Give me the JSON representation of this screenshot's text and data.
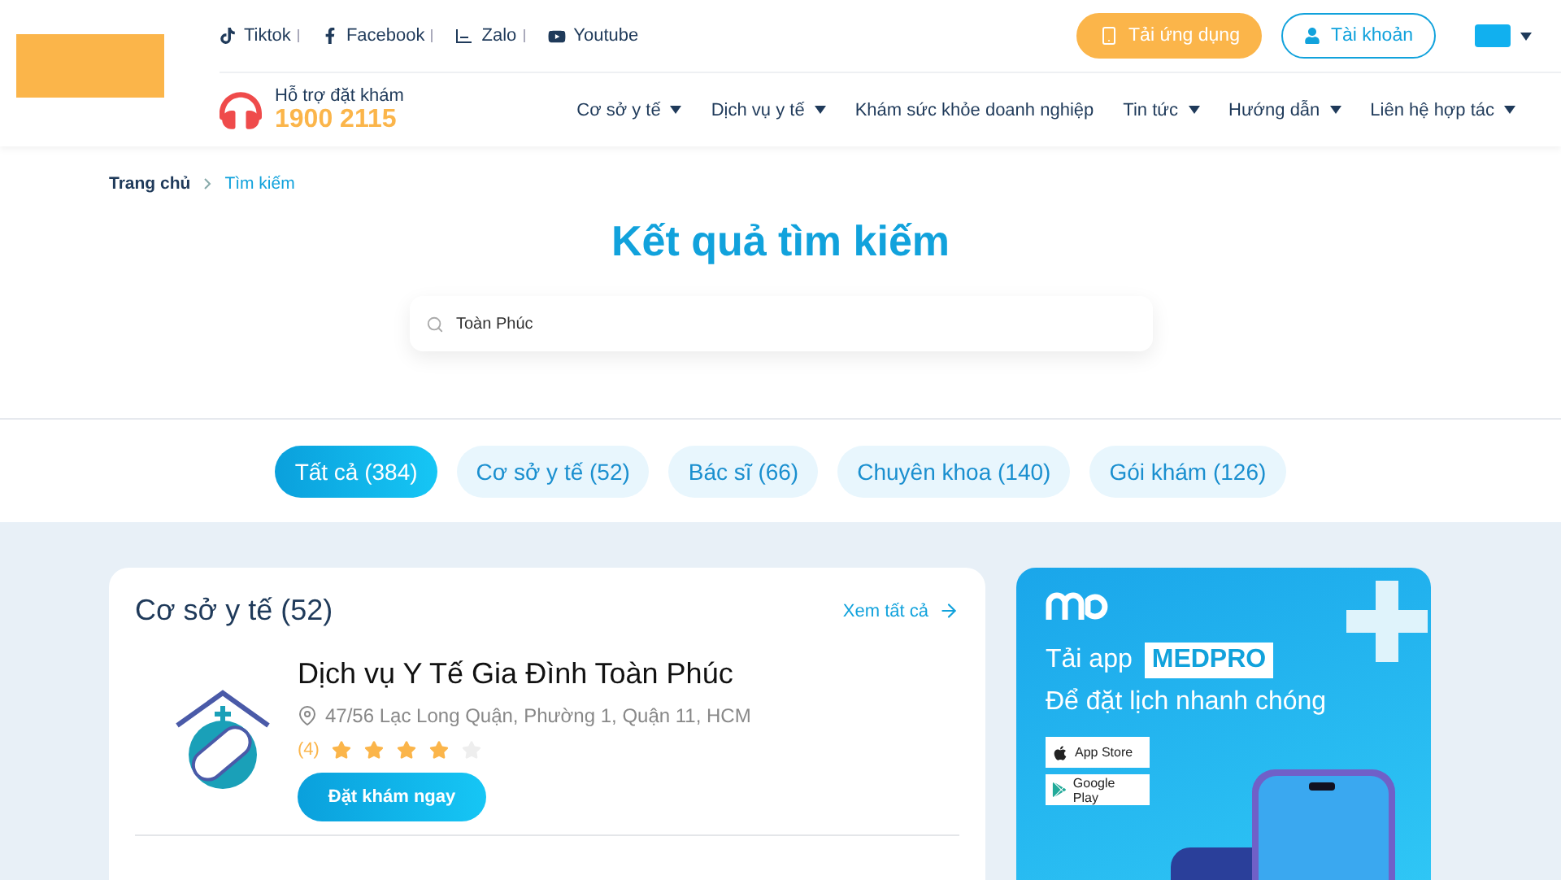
{
  "social_links": [
    {
      "kind": "tiktok",
      "label": "Tiktok"
    },
    {
      "kind": "facebook",
      "label": "Facebook"
    },
    {
      "kind": "zalo",
      "label": "Zalo"
    },
    {
      "kind": "youtube",
      "label": "Youtube"
    }
  ],
  "actions": [
    {
      "kind": "download",
      "label": "Tải ứng dụng"
    },
    {
      "kind": "account",
      "label": "Tài khoản"
    }
  ],
  "hotline": {
    "label": "Hỗ trợ đặt khám",
    "number": "1900 2115"
  },
  "nav": [
    {
      "label": "Cơ sở y tế",
      "dropdown": true
    },
    {
      "label": "Dịch vụ y tế",
      "dropdown": true
    },
    {
      "label": "Khám sức khỏe doanh nghiệp",
      "dropdown": false
    },
    {
      "label": "Tin tức",
      "dropdown": true
    },
    {
      "label": "Hướng dẫn",
      "dropdown": true
    },
    {
      "label": "Liên hệ hợp tác",
      "dropdown": true
    }
  ],
  "breadcrumb": [
    "Trang chủ",
    "Tìm kiếm"
  ],
  "page_title": "Kết quả tìm kiếm",
  "search": {
    "value": "Toàn Phúc"
  },
  "tabs": [
    {
      "label": "Tất cả (384)",
      "selected": true
    },
    {
      "label": "Cơ sở y tế (52)",
      "selected": false
    },
    {
      "label": "Bác sĩ (66)",
      "selected": false
    },
    {
      "label": "Chuyên khoa (140)",
      "selected": false
    },
    {
      "label": "Gói khám (126)",
      "selected": false
    }
  ],
  "results_card": {
    "title": "Cơ sở y tế (52)",
    "view_all": "Xem tất cả",
    "items": [
      {
        "name": "Dịch vụ Y Tế Gia Đình Toàn Phúc",
        "address": "47/56 Lạc Long Quận, Phường 1, Quận 11, HCM",
        "rating": "(4)",
        "stars": 4,
        "button": "Đặt khám ngay"
      }
    ]
  },
  "promo": {
    "line1": "Tải app",
    "brand": "MEDPRO",
    "line2": "Để đặt lịch nhanh chóng",
    "stores": [
      {
        "kind": "apple",
        "label": "App Store"
      },
      {
        "kind": "google",
        "label": "Google Play"
      }
    ]
  }
}
